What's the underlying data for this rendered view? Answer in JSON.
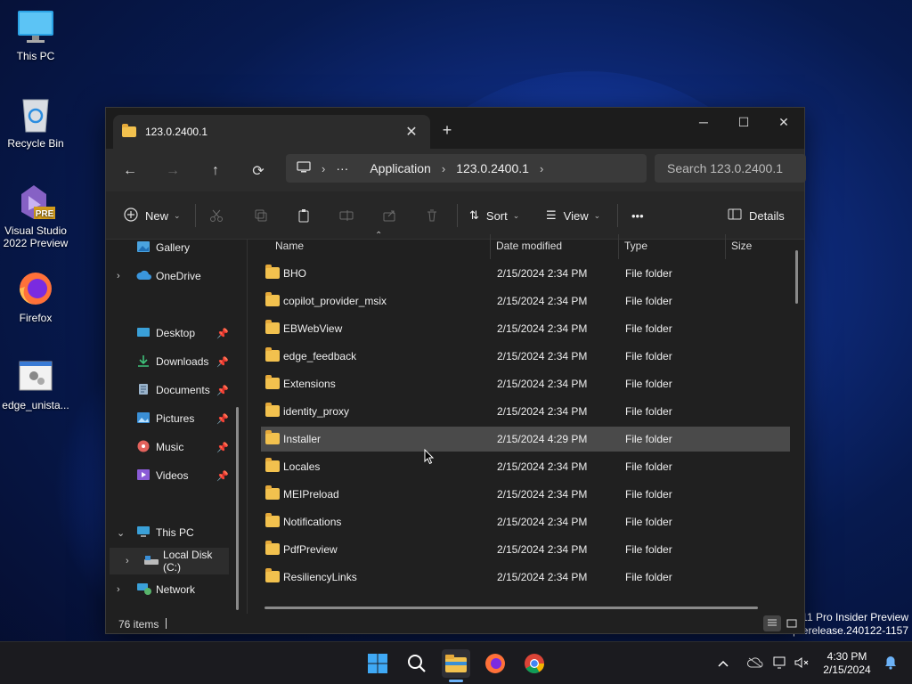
{
  "desktop": {
    "icons": [
      {
        "label": "This PC",
        "icon": "monitor-icon"
      },
      {
        "label": "Recycle Bin",
        "icon": "recycle-bin-icon"
      },
      {
        "label": "Visual Studio 2022 Preview",
        "icon": "visual-studio-icon",
        "badge": "PRE"
      },
      {
        "label": "Firefox",
        "icon": "firefox-icon"
      },
      {
        "label": "edge_unista...",
        "icon": "installer-file-icon"
      }
    ],
    "watermark": {
      "line1": "11 Pro Insider Preview",
      "line2": "prerelease.240122-1157"
    }
  },
  "window": {
    "tab_title": "123.0.2400.1",
    "new_tab": "+",
    "controls": {
      "minimize": "─",
      "maximize": "☐",
      "close": "✕"
    },
    "nav": {
      "back": "←",
      "forward": "→",
      "up": "↑",
      "refresh": "⟳"
    },
    "address": {
      "more": "···",
      "segments": [
        "Application",
        "123.0.2400.1"
      ],
      "sep": "›"
    },
    "search_placeholder": "Search 123.0.2400.1",
    "toolbar": {
      "new": "New",
      "sort": "Sort",
      "view": "View",
      "more": "•••",
      "details": "Details"
    },
    "sidebar": [
      {
        "label": "Gallery",
        "icon": "gallery-icon",
        "chevron": ""
      },
      {
        "label": "OneDrive",
        "icon": "onedrive-icon",
        "chevron": "›"
      },
      {
        "label": "Desktop",
        "icon": "desktop-icon",
        "pinned": true
      },
      {
        "label": "Downloads",
        "icon": "downloads-icon",
        "pinned": true
      },
      {
        "label": "Documents",
        "icon": "documents-icon",
        "pinned": true
      },
      {
        "label": "Pictures",
        "icon": "pictures-icon",
        "pinned": true
      },
      {
        "label": "Music",
        "icon": "music-icon",
        "pinned": true
      },
      {
        "label": "Videos",
        "icon": "videos-icon",
        "pinned": true
      },
      {
        "label": "This PC",
        "icon": "this-pc-icon",
        "chevron": "⌄"
      },
      {
        "label": "Local Disk (C:)",
        "icon": "local-disk-icon",
        "chevron": "›"
      },
      {
        "label": "Network",
        "icon": "network-icon",
        "chevron": "›"
      }
    ],
    "columns": {
      "name": "Name",
      "date": "Date modified",
      "type": "Type",
      "size": "Size"
    },
    "rows": [
      {
        "name": "BHO",
        "date": "2/15/2024 2:34 PM",
        "type": "File folder"
      },
      {
        "name": "copilot_provider_msix",
        "date": "2/15/2024 2:34 PM",
        "type": "File folder"
      },
      {
        "name": "EBWebView",
        "date": "2/15/2024 2:34 PM",
        "type": "File folder"
      },
      {
        "name": "edge_feedback",
        "date": "2/15/2024 2:34 PM",
        "type": "File folder"
      },
      {
        "name": "Extensions",
        "date": "2/15/2024 2:34 PM",
        "type": "File folder"
      },
      {
        "name": "identity_proxy",
        "date": "2/15/2024 2:34 PM",
        "type": "File folder"
      },
      {
        "name": "Installer",
        "date": "2/15/2024 4:29 PM",
        "type": "File folder"
      },
      {
        "name": "Locales",
        "date": "2/15/2024 2:34 PM",
        "type": "File folder"
      },
      {
        "name": "MEIPreload",
        "date": "2/15/2024 2:34 PM",
        "type": "File folder"
      },
      {
        "name": "Notifications",
        "date": "2/15/2024 2:34 PM",
        "type": "File folder"
      },
      {
        "name": "PdfPreview",
        "date": "2/15/2024 2:34 PM",
        "type": "File folder"
      },
      {
        "name": "ResiliencyLinks",
        "date": "2/15/2024 2:34 PM",
        "type": "File folder"
      }
    ],
    "status": "76 items"
  },
  "taskbar": {
    "time": "4:30 PM",
    "date": "2/15/2024"
  },
  "colors": {
    "accent": "#0078d4",
    "folder": "#f2c14e",
    "hover_row": "#4a4a4a"
  }
}
